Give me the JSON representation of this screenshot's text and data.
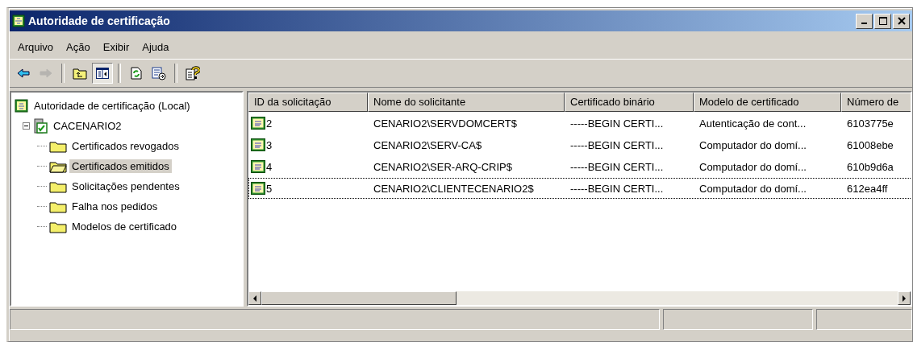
{
  "window": {
    "title": "Autoridade de certificação"
  },
  "menu": [
    {
      "label": "Arquivo"
    },
    {
      "label": "Ação"
    },
    {
      "label": "Exibir"
    },
    {
      "label": "Ajuda"
    }
  ],
  "toolbar": [
    {
      "kind": "back",
      "disabled": false,
      "pressed": false
    },
    {
      "kind": "forward",
      "disabled": true,
      "pressed": false
    },
    {
      "kind": "separator"
    },
    {
      "kind": "up",
      "disabled": false,
      "pressed": false
    },
    {
      "kind": "tree",
      "disabled": false,
      "pressed": true
    },
    {
      "kind": "separator"
    },
    {
      "kind": "refresh",
      "disabled": false,
      "pressed": false
    },
    {
      "kind": "export",
      "disabled": false,
      "pressed": false
    },
    {
      "kind": "separator"
    },
    {
      "kind": "help",
      "disabled": false,
      "pressed": false
    }
  ],
  "tree": {
    "label": "Autoridade de certificação (Local)",
    "children": [
      {
        "label": "CACENARIO2",
        "expanded": true,
        "children": [
          {
            "label": "Certificados revogados",
            "selected": false
          },
          {
            "label": "Certificados emitidos",
            "selected": true
          },
          {
            "label": "Solicitações pendentes",
            "selected": false
          },
          {
            "label": "Falha nos pedidos",
            "selected": false
          },
          {
            "label": "Modelos de certificado",
            "selected": false
          }
        ]
      }
    ]
  },
  "table": {
    "columns": [
      "ID da solicitação",
      "Nome do solicitante",
      "Certificado binário",
      "Modelo de certificado",
      "Número de"
    ],
    "rows": [
      {
        "focused": false,
        "cells": [
          "2",
          "CENARIO2\\SERVDOMCERT$",
          "-----BEGIN CERTI...",
          "Autenticação de cont...",
          "6103775e"
        ]
      },
      {
        "focused": false,
        "cells": [
          "3",
          "CENARIO2\\SERV-CA$",
          "-----BEGIN CERTI...",
          "Computador do domí...",
          "61008ebe"
        ]
      },
      {
        "focused": false,
        "cells": [
          "4",
          "CENARIO2\\SER-ARQ-CRIP$",
          "-----BEGIN CERTI...",
          "Computador do domí...",
          "610b9d6a"
        ]
      },
      {
        "focused": true,
        "cells": [
          "5",
          "CENARIO2\\CLIENTECENARIO2$",
          "-----BEGIN CERTI...",
          "Computador do domí...",
          "612ea4ff"
        ]
      }
    ]
  }
}
